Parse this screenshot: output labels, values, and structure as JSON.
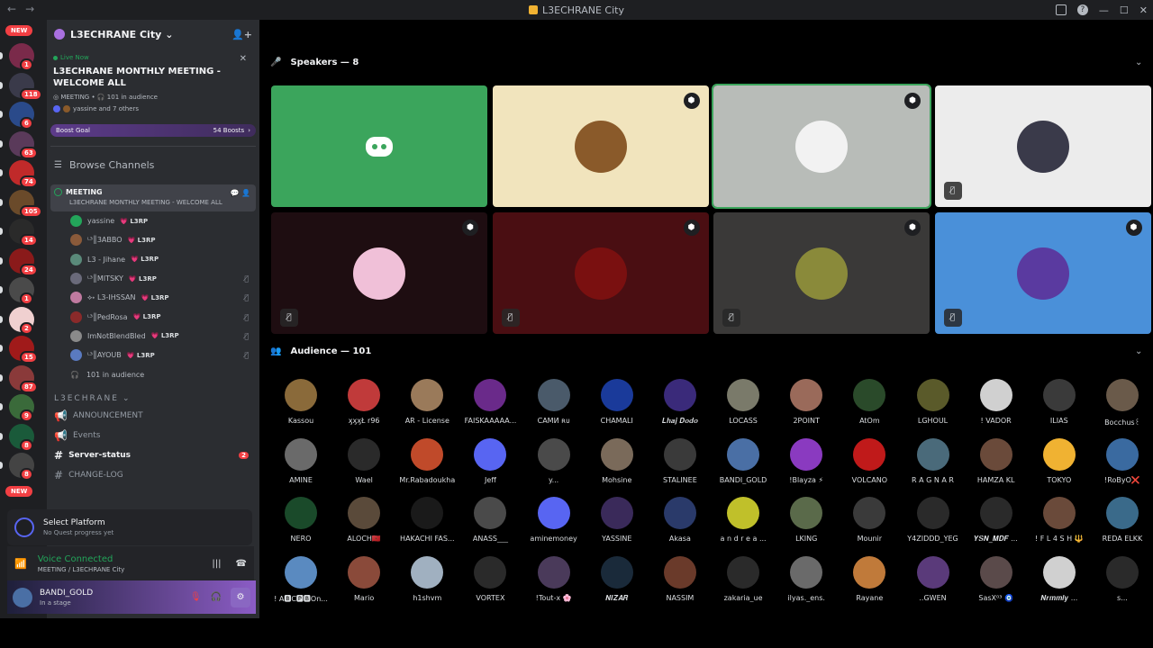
{
  "window": {
    "title": "L3ECHRANE City"
  },
  "rail": {
    "new_top": "NEW",
    "new_bottom": "NEW",
    "badges": [
      "1",
      "118",
      "6",
      "63",
      "74",
      "105",
      "14",
      "24",
      "1",
      "2",
      "15",
      "87",
      "9",
      "8",
      "8"
    ]
  },
  "guild": {
    "name": "L3ECHRANE City"
  },
  "live": {
    "label": "Live Now",
    "title": "L3ECHRANE MONTHLY MEETING - WELCOME ALL",
    "channel": "MEETING",
    "audience": "101 in audience",
    "speakers": "yassine and 7 others"
  },
  "boost": {
    "label": "Boost Goal",
    "count": "54 Boosts"
  },
  "browse": "Browse Channels",
  "stage": {
    "name": "MEETING",
    "desc": "L3ECHRANE MONTHLY MEETING - WELCOME ALL",
    "users": [
      {
        "name": "yassine",
        "tag": "L3RP",
        "color": "#23a55a",
        "muted": false
      },
      {
        "name": "ᴸ³║3ABBO",
        "tag": "L3RP",
        "color": "#8a5a3a",
        "muted": false
      },
      {
        "name": "L3 - Jihane",
        "tag": "L3RP",
        "color": "#5a8a7a",
        "muted": false
      },
      {
        "name": "ᴸ³║MITSKY",
        "tag": "L3RP",
        "color": "#6a6a7a",
        "muted": true
      },
      {
        "name": "⟡˖ L3-IHSSAN",
        "tag": "L3RP",
        "color": "#c07aa0",
        "muted": true
      },
      {
        "name": "ᴸ³║PedRosa",
        "tag": "L3RP",
        "color": "#8a2a2a",
        "muted": true
      },
      {
        "name": "ImNotBlendBled",
        "tag": "L3RP",
        "color": "#8a8a8a",
        "muted": true
      },
      {
        "name": "ᴸ³║AYOUB",
        "tag": "L3RP",
        "color": "#5a7ac0",
        "muted": true
      }
    ],
    "audience": "101 in audience"
  },
  "category": "L3ECHRANE",
  "channels": [
    {
      "name": "ANNOUNCEMENT",
      "bold": false,
      "badge": ""
    },
    {
      "name": "Events",
      "bold": false,
      "badge": ""
    },
    {
      "name": "Server-status",
      "bold": true,
      "badge": "2"
    },
    {
      "name": "CHANGE-LOG",
      "bold": false,
      "badge": ""
    }
  ],
  "quest": {
    "title": "Select Platform",
    "sub": "No Quest progress yet"
  },
  "voice": {
    "status": "Voice Connected",
    "where": "MEETING / L3ECHRANE City"
  },
  "user": {
    "name": "BANDI_GOLD",
    "status": "In a stage"
  },
  "speakers": {
    "label": "Speakers — 8",
    "tiles": [
      {
        "bg": "#3ba55c",
        "face": "discord",
        "mod": false,
        "muted": false,
        "selected": false
      },
      {
        "bg": "#f1e4bd",
        "face": "#8a5a2a",
        "mod": true,
        "muted": false,
        "selected": false
      },
      {
        "bg": "#b8bcb8",
        "face": "#f2f2f2",
        "mod": true,
        "muted": false,
        "selected": true
      },
      {
        "bg": "#ececec",
        "face": "#3a3a4a",
        "mod": false,
        "muted": true,
        "selected": false
      },
      {
        "bg": "#1e0d11",
        "face": "#f0c0d8",
        "mod": true,
        "muted": true,
        "selected": false
      },
      {
        "bg": "#4a0e12",
        "face": "#7a1010",
        "mod": true,
        "muted": true,
        "selected": false
      },
      {
        "bg": "#3a3938",
        "face": "#8a8a3a",
        "mod": true,
        "muted": true,
        "selected": false
      },
      {
        "bg": "#4a90d9",
        "face": "#5a3aa0",
        "mod": true,
        "muted": true,
        "selected": false
      }
    ]
  },
  "audience": {
    "label": "Audience — 101",
    "members": [
      {
        "name": "Kassou",
        "color": "#8a6a3a"
      },
      {
        "name": "ӽӽӽŁ r96",
        "color": "#c03a3a"
      },
      {
        "name": "AR - License",
        "color": "#9a7a5a"
      },
      {
        "name": "FAISKAAAAA...",
        "color": "#6a2a8a"
      },
      {
        "name": "САМИ ʀᴜ",
        "color": "#4a5a6a"
      },
      {
        "name": "CHAMALI",
        "color": "#1a3a9a"
      },
      {
        "name": "𝑳𝒉𝒂𝒋 𝑫𝒐𝒅𝒐",
        "color": "#3a2a7a"
      },
      {
        "name": "LOCASS",
        "color": "#7a7a6a"
      },
      {
        "name": "2POINT",
        "color": "#9a6a5a"
      },
      {
        "name": "AtOm",
        "color": "#2a4a2a"
      },
      {
        "name": "LGHOUL",
        "color": "#5a5a2a"
      },
      {
        "name": "! VADOR",
        "color": "#d0d0d0"
      },
      {
        "name": "ILIAS",
        "color": "#3a3a3a"
      },
      {
        "name": "Bocchus꒰",
        "color": "#6a5a4a"
      },
      {
        "name": "AMINE",
        "color": "#6a6a6a"
      },
      {
        "name": "Wael",
        "color": "#2a2a2a"
      },
      {
        "name": "Mr.Rabadoukha",
        "color": "#c04a2a"
      },
      {
        "name": "Jeff",
        "color": "#5865f2"
      },
      {
        "name": "y...",
        "color": "#4a4a4a"
      },
      {
        "name": "Mohsine",
        "color": "#7a6a5a"
      },
      {
        "name": "STALINEE",
        "color": "#3a3a3a"
      },
      {
        "name": "BANDI_GOLD",
        "color": "#4a6fa5"
      },
      {
        "name": "!Blayza ⚡",
        "color": "#8a3ac0"
      },
      {
        "name": "VOLCANO",
        "color": "#c01a1a"
      },
      {
        "name": "R A G N A R",
        "color": "#4a6a7a"
      },
      {
        "name": "HAMZA KL",
        "color": "#6a4a3a"
      },
      {
        "name": "TOKYO",
        "color": "#f0b232"
      },
      {
        "name": "!RoByO❌",
        "color": "#3a6aa0"
      },
      {
        "name": "NERO",
        "color": "#1a4a2a"
      },
      {
        "name": "ALOCH🇲🇦",
        "color": "#5a4a3a"
      },
      {
        "name": "HAKACHI FAS...",
        "color": "#1a1a1a"
      },
      {
        "name": "ANASS___",
        "color": "#4a4a4a"
      },
      {
        "name": "aminemoney",
        "color": "#5865f2"
      },
      {
        "name": "YASSINE",
        "color": "#3a2a5a"
      },
      {
        "name": "Akasa",
        "color": "#2a3a6a"
      },
      {
        "name": "a n d r e a ...",
        "color": "#c0c02a"
      },
      {
        "name": "LKING",
        "color": "#5a6a4a"
      },
      {
        "name": "Mounir",
        "color": "#3a3a3a"
      },
      {
        "name": "Y4ZIDDD_YEG",
        "color": "#2a2a2a"
      },
      {
        "name": "𝒀𝑺𝑵_𝑴𝑫𝑭 ...",
        "color": "#2a2a2a"
      },
      {
        "name": "! F L 4 S H 🔱",
        "color": "#6a4a3a"
      },
      {
        "name": "REDA ELKK",
        "color": "#3a6a8a"
      },
      {
        "name": "! A🅱C🅿🅱On...",
        "color": "#5a8ac0"
      },
      {
        "name": "Mario",
        "color": "#8a4a3a"
      },
      {
        "name": "h1shvm",
        "color": "#a0b0c0"
      },
      {
        "name": "VORTEX",
        "color": "#2a2a2a"
      },
      {
        "name": "!Tout-x 🌸",
        "color": "#4a3a5a"
      },
      {
        "name": "𝑵𝑰𝒁𝑨𝑹",
        "color": "#1a2a3a"
      },
      {
        "name": "NASSIM",
        "color": "#6a3a2a"
      },
      {
        "name": "zakaria_ue",
        "color": "#2a2a2a"
      },
      {
        "name": "ilyas._ens.",
        "color": "#6a6a6a"
      },
      {
        "name": "Rayane",
        "color": "#c07a3a"
      },
      {
        "name": "..GWEN",
        "color": "#5a3a7a"
      },
      {
        "name": "SasX⁰³ 🧿",
        "color": "#5a4a4a"
      },
      {
        "name": "𝑵𝒓𝒎𝒎𝒍𝒚 ...",
        "color": "#d0d0d0"
      },
      {
        "name": "s...",
        "color": "#2a2a2a"
      }
    ]
  }
}
